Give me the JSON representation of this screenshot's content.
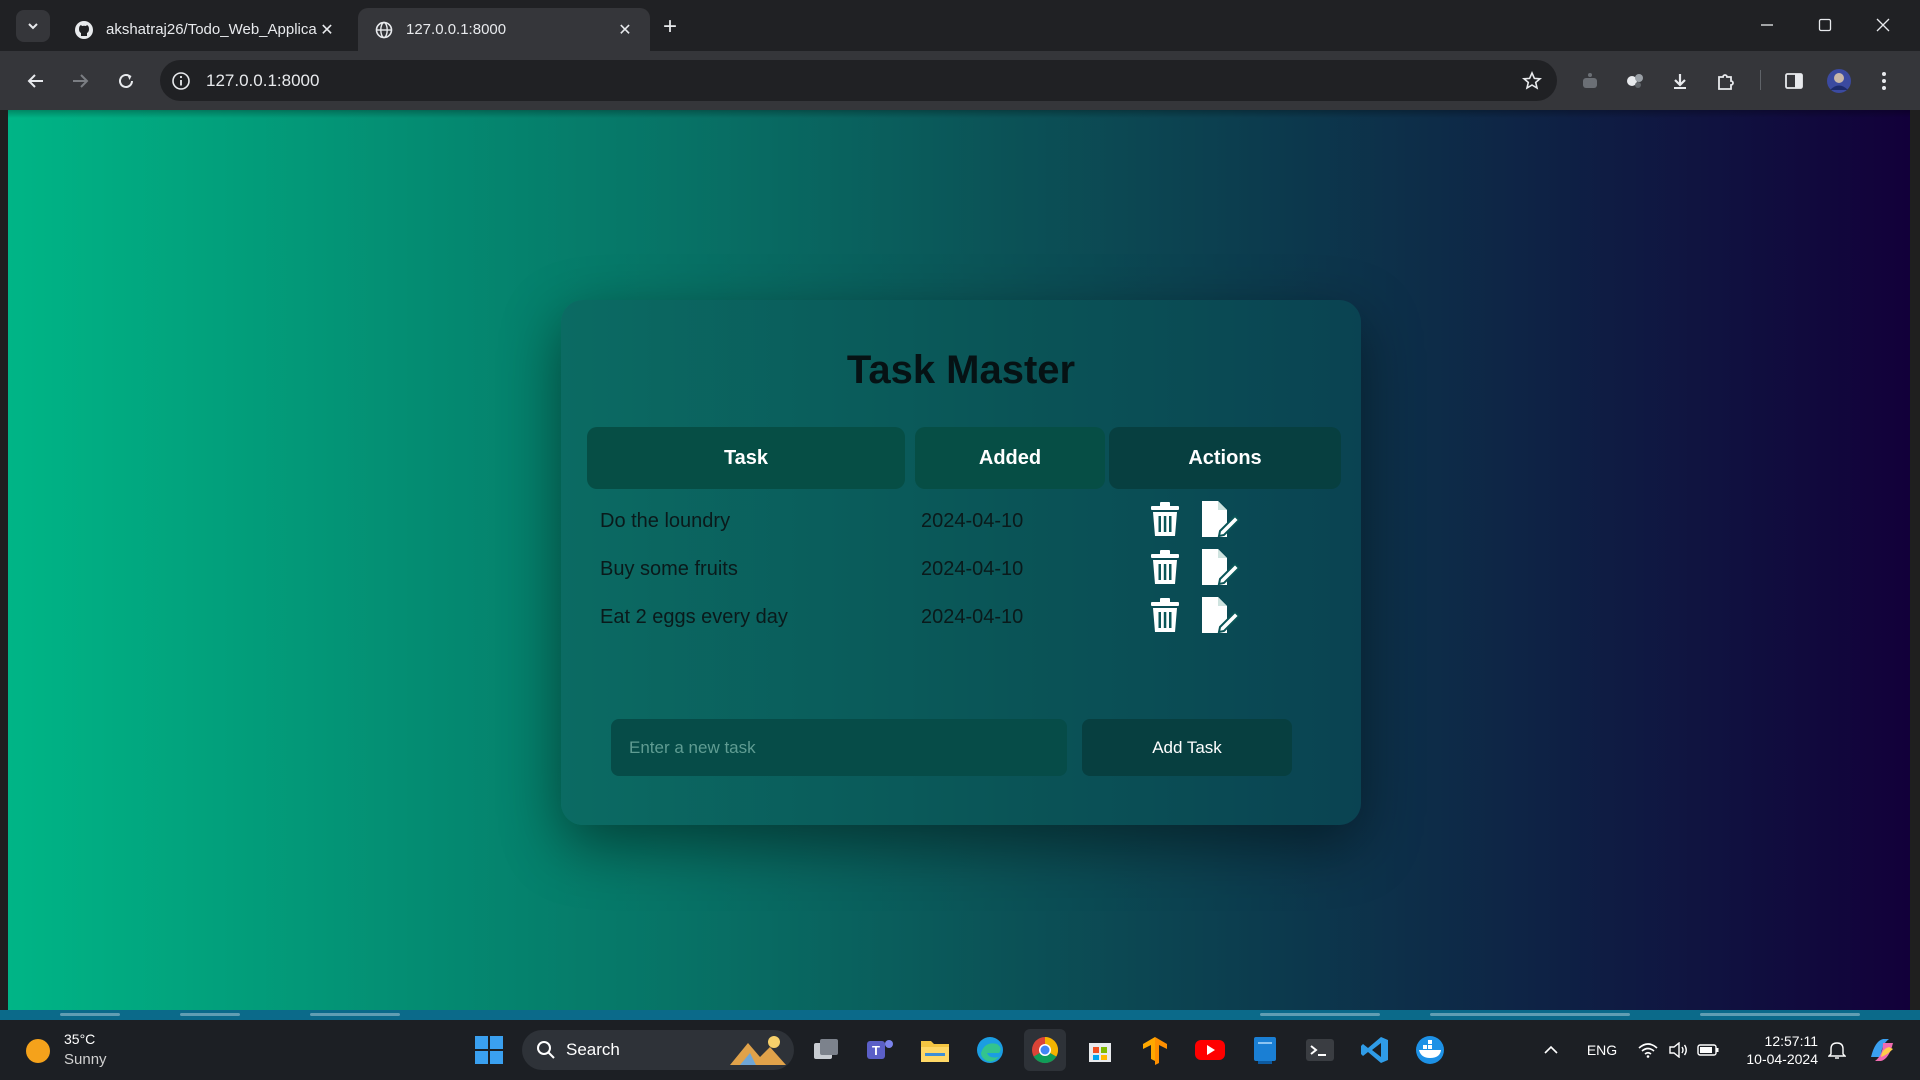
{
  "browser": {
    "tabs": [
      {
        "title": "akshatraj26/Todo_Web_Applica",
        "favicon": "github-icon",
        "active": false
      },
      {
        "title": "127.0.0.1:8000",
        "favicon": "globe-icon",
        "active": true
      }
    ],
    "address": "127.0.0.1:8000"
  },
  "app": {
    "title": "Task Master",
    "columns": {
      "task": "Task",
      "added": "Added",
      "actions": "Actions"
    },
    "tasks": [
      {
        "content": "Do the loundry",
        "added": "2024-04-10"
      },
      {
        "content": "Buy some fruits",
        "added": "2024-04-10"
      },
      {
        "content": "Eat 2 eggs every day",
        "added": "2024-04-10"
      }
    ],
    "input_placeholder": "Enter a new task",
    "add_button": "Add Task"
  },
  "taskbar": {
    "weather": {
      "temp": "35°C",
      "condition": "Sunny"
    },
    "search_label": "Search",
    "language": "ENG",
    "time": "12:57:11",
    "date": "10-04-2024"
  },
  "colors": {
    "gradient_start": "#00b586",
    "gradient_end": "#12003a",
    "card": "#0a5557",
    "header_cell": "#064e45"
  }
}
